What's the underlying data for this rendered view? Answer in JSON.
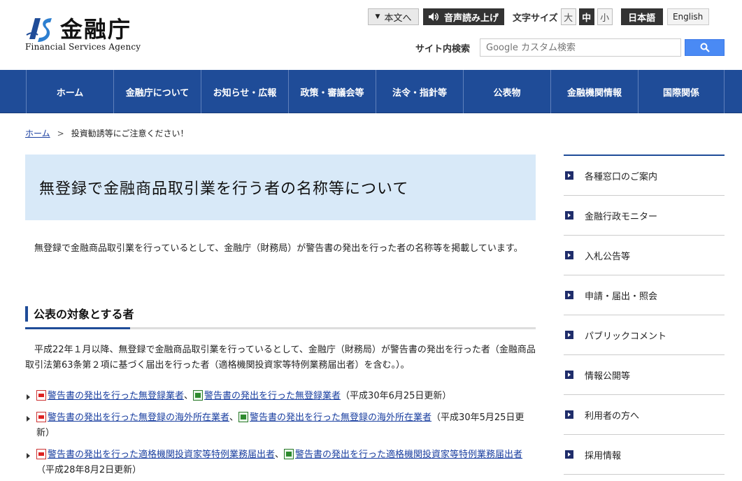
{
  "header": {
    "logo_title": "金融庁",
    "logo_subtitle": "Financial Services Agency",
    "main_text_button": "本文へ",
    "voice_button": "音声読み上げ",
    "font_size_label": "文字サイズ",
    "font_sizes": [
      "大",
      "中",
      "小"
    ],
    "active_font_size": "中",
    "lang_ja": "日本語",
    "lang_en": "English",
    "search_label": "サイト内検索",
    "search_placeholder": "Google カスタム検索"
  },
  "nav": {
    "items": [
      "ホーム",
      "金融庁について",
      "お知らせ・広報",
      "政策・審議会等",
      "法令・指針等",
      "公表物",
      "金融機関情報",
      "国際関係"
    ]
  },
  "breadcrumb": {
    "home": "ホーム",
    "separator": ">",
    "current": "投資勧誘等にご注意ください！"
  },
  "main": {
    "title": "無登録で金融商品取引業を行う者の名称等について",
    "intro": "無登録で金融商品取引業を行っているとして、金融庁（財務局）が警告書の発出を行った者の名称等を掲載しています。",
    "section_title": "公表の対象とする者",
    "section_text": "平成22年１月以降、無登録で金融商品取引業を行っているとして、金融庁（財務局）が警告書の発出を行った者（金融商品取引法第63条第２項に基づく届出を行った者（適格機関投資家等特例業務届出者）を含む。）。",
    "links": [
      {
        "pdf_link": "警告書の発出を行った無登録業者",
        "sep": "、",
        "xls_link": "警告書の発出を行った無登録業者",
        "note": "（平成30年6月25日更新）"
      },
      {
        "pdf_link": "警告書の発出を行った無登録の海外所在業者",
        "sep": "、",
        "xls_link": "警告書の発出を行った無登録の海外所在業者",
        "note": "（平成30年5月25日更新）"
      },
      {
        "pdf_link": "警告書の発出を行った適格機関投資家等特例業務届出者",
        "sep": "、",
        "xls_link": "警告書の発出を行った適格機関投資家等特例業務届出者",
        "note": "（平成28年8月2日更新）"
      }
    ]
  },
  "sidebar": {
    "items": [
      "各種窓口のご案内",
      "金融行政モニター",
      "入札公告等",
      "申請・届出・照会",
      "パブリックコメント",
      "情報公開等",
      "利用者の方へ",
      "採用情報"
    ]
  },
  "colors": {
    "nav_bg": "#1f4c98",
    "title_bg": "#d8e9f8",
    "link": "#1a3fa0",
    "search_button": "#4a8af4"
  }
}
